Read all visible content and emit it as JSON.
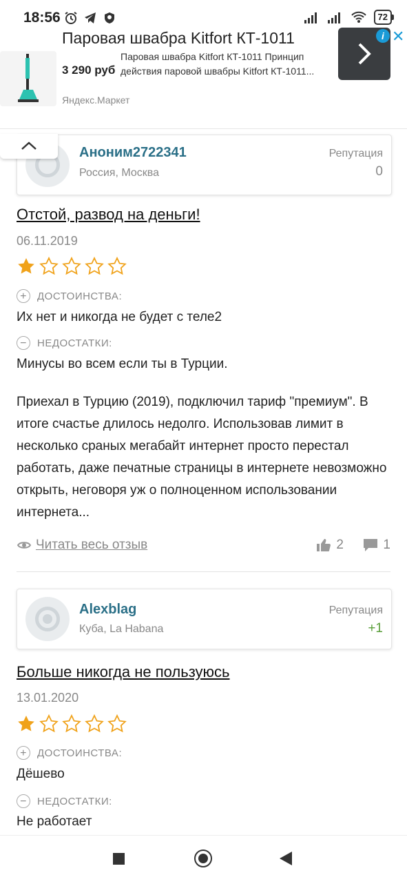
{
  "status": {
    "time": "18:56",
    "battery": "72"
  },
  "ad": {
    "title": "Паровая швабра Kitfort КТ-1011",
    "price": "3 290 руб",
    "description": "Паровая швабра Kitfort КТ-1011 Принцип действия паровой швабры Kitfort КТ-1011...",
    "source": "Яндекс.Маркет",
    "info_icon": "i",
    "close_icon": "✕"
  },
  "reviews": [
    {
      "author": "Аноним2722341",
      "location": "Россия, Москва",
      "reputation_label": "Репутация",
      "reputation": "0",
      "reputation_color": "#888888",
      "title": "Отстой, развод на деньги!",
      "date": "06.11.2019",
      "rating": 1,
      "pros_label": "ДОСТОИНСТВА:",
      "pros": "Их нет и никогда не будет с теле2",
      "cons_label": "НЕДОСТАТКИ:",
      "cons": "Минусы во всем если ты в Турции.",
      "body": "Приехал в Турцию (2019), подключил тариф \"премиум\". В итоге счастье длилось недолго. Использовав лимит в несколько сраных мегабайт интернет просто перестал работать, даже печатные страницы в интернете невозможно открыть, неговоря уж о полноценном использовании интернета...",
      "read_more": "Читать весь отзыв",
      "likes": "2",
      "comments": "1"
    },
    {
      "author": "Alexblag",
      "location": "Куба, La Habana",
      "reputation_label": "Репутация",
      "reputation": "+1",
      "reputation_color": "#5a9e3a",
      "title": "Больше никогда не пользуюсь",
      "date": "13.01.2020",
      "rating": 1,
      "pros_label": "ДОСТОИНСТВА:",
      "pros": "Дёшево",
      "cons_label": "НЕДОСТАТКИ:",
      "cons": "Не работает"
    }
  ],
  "colors": {
    "star_filled": "#f0a21a",
    "star_empty": "#f0a21a",
    "author_link": "#2a6f87"
  }
}
